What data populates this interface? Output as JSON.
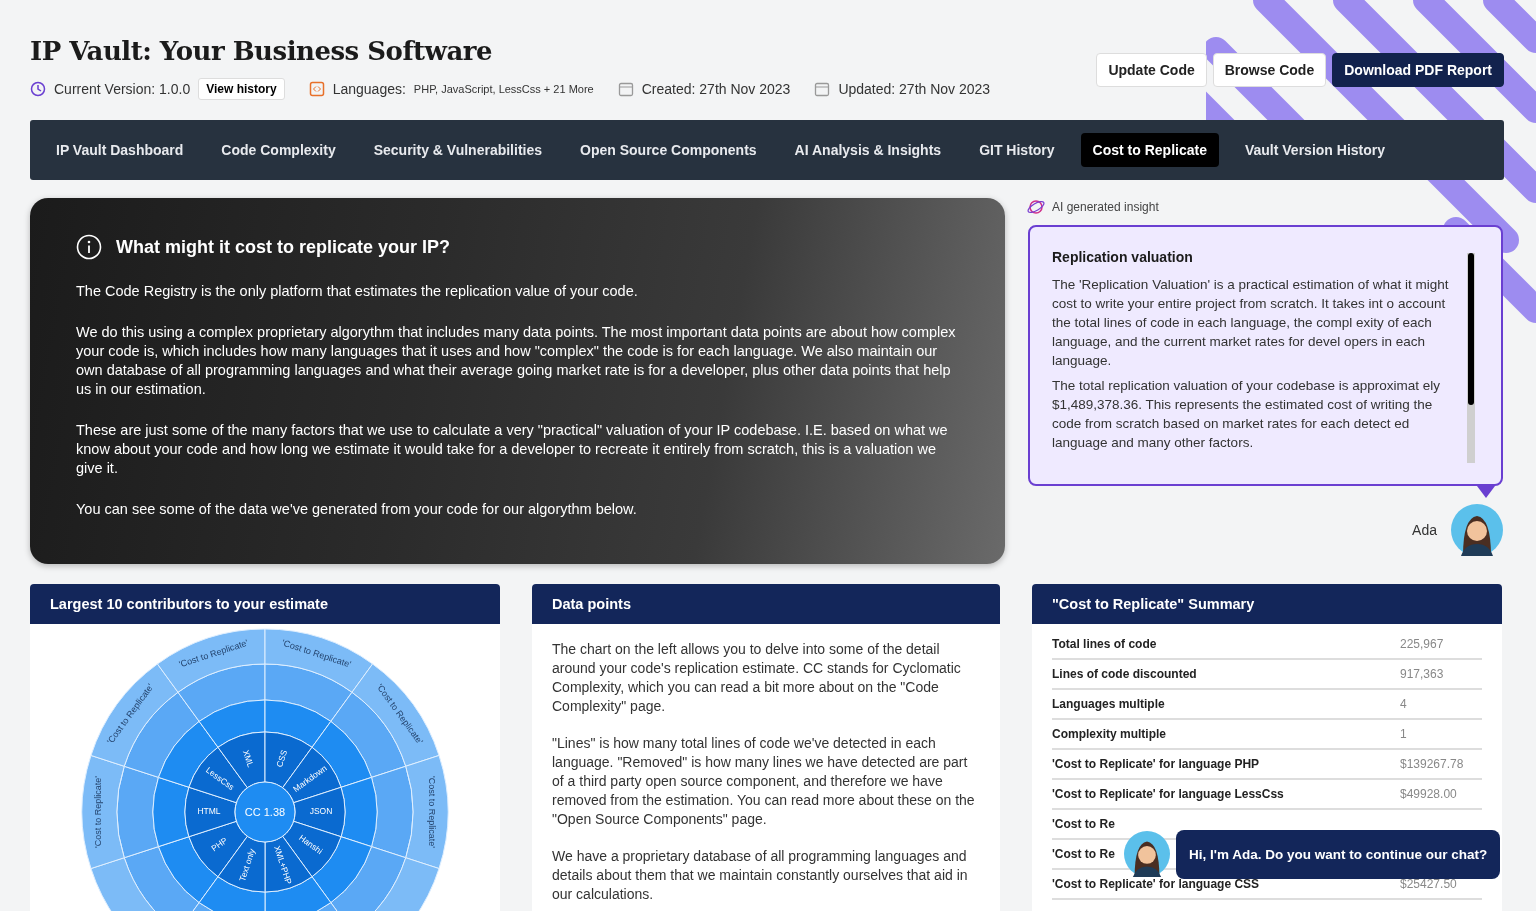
{
  "header": {
    "title": "IP Vault: Your Business Software",
    "version": "Current Version: 1.0.0",
    "history_button": "View history",
    "languages_label": "Languages:",
    "languages_value": "PHP, JavaScript, LessCss + 21 More",
    "created": "Created: 27th Nov 2023",
    "updated": "Updated: 27th Nov 2023",
    "buttons": [
      {
        "label": "Update Code",
        "kind": "outline"
      },
      {
        "label": "Browse Code",
        "kind": "outline"
      },
      {
        "label": "Download PDF Report",
        "kind": "primary"
      }
    ]
  },
  "tabs": [
    {
      "label": "IP Vault Dashboard",
      "selected": false
    },
    {
      "label": "Code Complexity",
      "selected": false
    },
    {
      "label": "Security & Vulnerabilities",
      "selected": false
    },
    {
      "label": "Open Source Components",
      "selected": false
    },
    {
      "label": "AI Analysis & Insights",
      "selected": false
    },
    {
      "label": "GIT History",
      "selected": false
    },
    {
      "label": "Cost to Replicate",
      "selected": true
    },
    {
      "label": "Vault Version History",
      "selected": false
    }
  ],
  "hero": {
    "title": "What might it cost to replicate your IP?",
    "paragraphs": [
      "The Code Registry is the only platform that estimates the replication value of your code.",
      "We do this using a complex proprietary algorythm that includes many data points. The most important data points are about how complex your code is, which includes how many languages that it uses and how \"complex\" the code is for each language. We also maintain our own database of all programming languages and what their average going market rate is for a developer, plus other data points that help us in our estimation.",
      "These are just some of the many factors that we use to calculate a very \"practical\" valuation of your IP codebase. I.E. based on what we know about your code and how long we estimate it would take for a developer to recreate it entirely from scratch, this is a valuation we give it.",
      "You can see some of the data we've generated from your code for our algorythm below."
    ]
  },
  "insight": {
    "label": "AI generated insight",
    "title": "Replication valuation",
    "paragraphs": [
      "The 'Replication Valuation' is a practical estimation of what it might cost to write your entire project from scratch. It takes int o account the total lines of code in each language, the compl exity of each language, and the current market rates for devel opers in each language.",
      "The total replication valuation of your codebase is approximat ely $1,489,378.36. This represents the estimated cost of writing the code from scratch based on market rates for each detect ed language and many other factors."
    ],
    "assistant_name": "Ada"
  },
  "contributors": {
    "title": "Largest 10 contributors to your estimate",
    "center_label": "CC 1.38",
    "languages": [
      "PHP",
      "HTML",
      "LessCss",
      "XML",
      "CSS",
      "Markdown",
      "JSON",
      "Hanshi",
      "XML+PHP",
      "Text only"
    ],
    "outer_labels": [
      "'Cost to Replicate'",
      "'Cost to Replicate'",
      "'Cost to Replicate'",
      "'Cost to Replicate'",
      "'Cost to Replicate'",
      "'Cost to Replicate'"
    ]
  },
  "data_points": {
    "title": "Data points",
    "paragraphs": [
      "The chart on the left allows you to delve into some of the detail around your code's replication estimate. CC stands for Cyclomatic Complexity, which you can read a bit more about on the \"Code Complexity\" page.",
      "\"Lines\" is how many total lines of code we've detected in each language. \"Removed\" is how many lines we have detected are part of a third party open source component, and therefore we have removed from the estimation. You can read more about these on the \"Open Source Components\" page.",
      "We have a proprietary database of all programming languages and details about them that we maintain constantly ourselves that aid in our calculations."
    ]
  },
  "summary": {
    "title": "\"Cost to Replicate\" Summary",
    "rows": [
      {
        "label": "Total lines of code",
        "value": "225,967"
      },
      {
        "label": "Lines of code discounted",
        "value": "917,363"
      },
      {
        "label": "Languages multiple",
        "value": "4"
      },
      {
        "label": "Complexity multiple",
        "value": "1"
      },
      {
        "label": "'Cost to Replicate' for language PHP",
        "value": "$139267.78"
      },
      {
        "label": "'Cost to Replicate' for language LessCss",
        "value": "$49928.00"
      },
      {
        "label": "'Cost to Re"
      },
      {
        "label": "'Cost to Re"
      },
      {
        "label": "'Cost to Replicate' for language CSS",
        "value": "$25427.50"
      }
    ]
  },
  "chat": {
    "message": "Hi, I'm Ada. Do you want to continue our chat?"
  }
}
